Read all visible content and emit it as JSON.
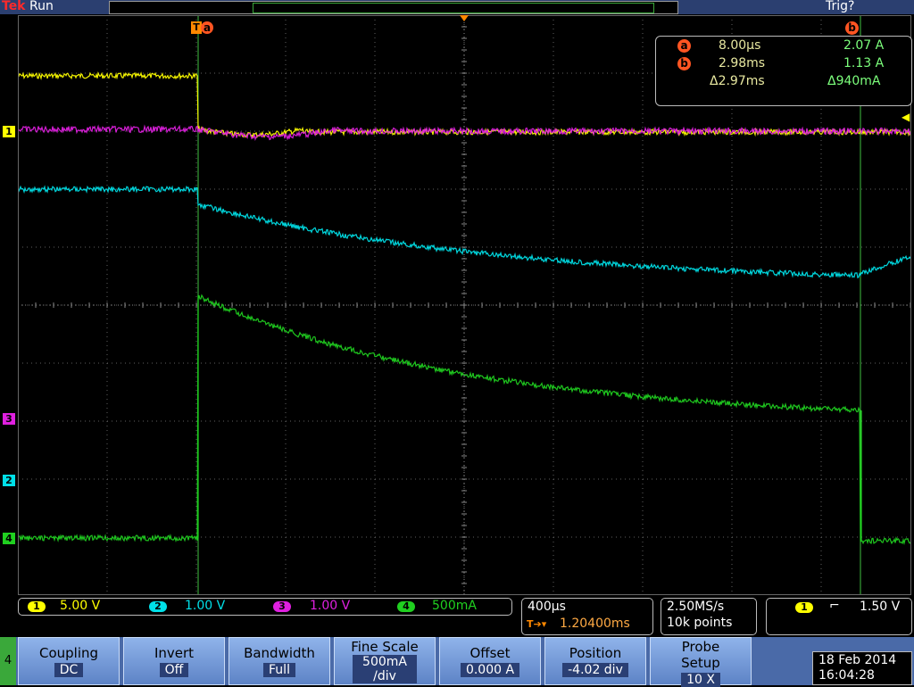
{
  "header": {
    "brand": "Tek",
    "mode": "Run",
    "trigger_state": "Trig?"
  },
  "colors": {
    "ch1": "#ffff00",
    "ch2": "#00e0e8",
    "ch3": "#e020e0",
    "ch4": "#20d020",
    "cursor": "#ff5522",
    "grid": "#888888"
  },
  "markers": {
    "trigger_pos": "T",
    "cursor_a": "a",
    "cursor_b": "b"
  },
  "channel_markers": {
    "ch1": "1",
    "ch3": "3",
    "ch2": "2",
    "ch4": "4"
  },
  "cursor_readout": {
    "a_time": "8.00µs",
    "a_value": "2.07 A",
    "b_time": "2.98ms",
    "b_value": "1.13 A",
    "delta_time": "Δ2.97ms",
    "delta_value": "Δ940mA"
  },
  "channels": [
    {
      "num": "1",
      "scale": "5.00 V"
    },
    {
      "num": "2",
      "scale": "1.00 V"
    },
    {
      "num": "3",
      "scale": "1.00 V"
    },
    {
      "num": "4",
      "scale": "500mA"
    }
  ],
  "timebase": {
    "scale": "400µs",
    "delay": "1.20400ms"
  },
  "acquisition": {
    "rate": "2.50MS/s",
    "points": "10k points"
  },
  "trigger": {
    "source": "1",
    "level": "1.50 V"
  },
  "menu": {
    "side_key": "4",
    "buttons": [
      {
        "label": "Coupling",
        "value": "DC"
      },
      {
        "label": "Invert",
        "value": "Off"
      },
      {
        "label": "Bandwidth",
        "value": "Full"
      },
      {
        "label": "Fine Scale",
        "value": "500mA",
        "value2": "/div"
      },
      {
        "label": "Offset",
        "value": "0.000 A"
      },
      {
        "label": "Position",
        "value": "-4.02 div"
      },
      {
        "label": "Probe",
        "label2": "Setup",
        "value": "10 X"
      }
    ]
  },
  "datetime": {
    "date": "18 Feb  2014",
    "time": "16:04:28"
  }
}
